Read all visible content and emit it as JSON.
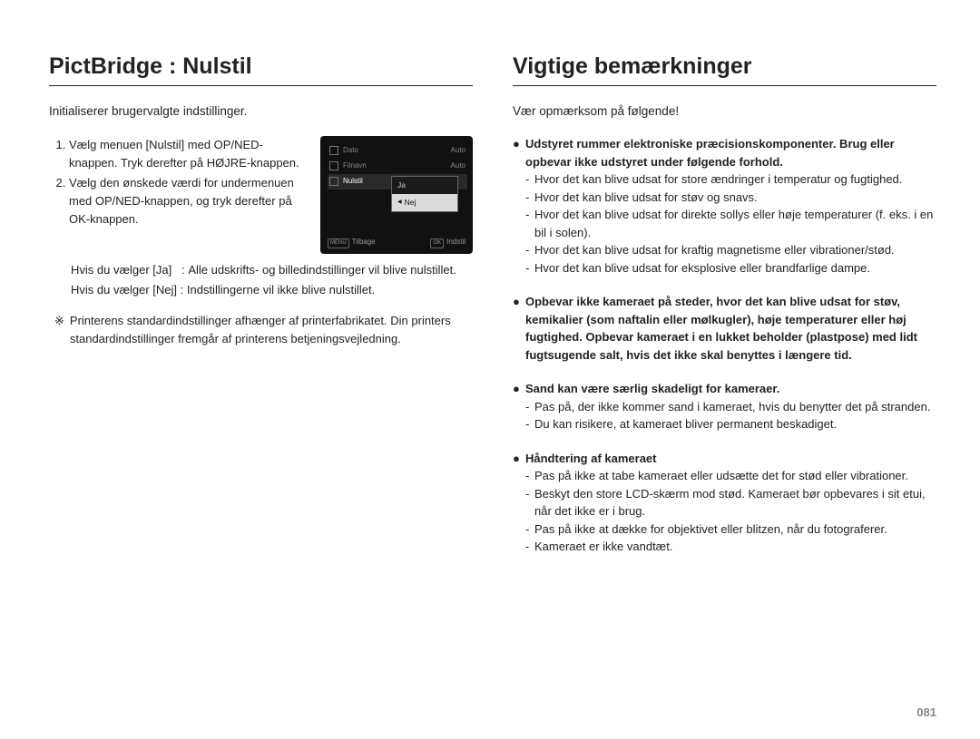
{
  "pageNumber": "081",
  "left": {
    "title": "PictBridge : Nulstil",
    "intro": "Initialiserer brugervalgte indstillinger.",
    "steps": [
      "Vælg menuen [Nulstil] med OP/NED-knappen. Tryk derefter på HØJRE-knappen.",
      "Vælg den ønskede værdi for undermenuen med OP/NED-knappen, og tryk derefter på OK-knappen."
    ],
    "result_yes_label": "Hvis du vælger [Ja]   : ",
    "result_yes_text": "Alle udskrifts- og billedindstillinger vil blive nulstillet.",
    "result_no_label": "Hvis du vælger [Nej] : ",
    "result_no_text": "Indstillingerne vil ikke blive nulstillet.",
    "note_sym": "※",
    "note_text": "Printerens standardindstillinger afhænger af printerfabrikatet. Din printers standardindstillinger fremgår af printerens betjeningsvejledning.",
    "lcd": {
      "rows": [
        {
          "label": "Dato",
          "right": "Auto"
        },
        {
          "label": "Filnavn",
          "right": "Auto"
        },
        {
          "label": "Nulstil",
          "right": ""
        }
      ],
      "sub": {
        "opt1": "Ja",
        "opt2": "Nej"
      },
      "footer_back_badge": "MENU",
      "footer_back": "Tilbage",
      "footer_set_badge": "OK",
      "footer_set": "Indstil"
    }
  },
  "right": {
    "title": "Vigtige bemærkninger",
    "intro": "Vær opmærksom på følgende!",
    "bullets": [
      {
        "head": "Udstyret rummer elektroniske præcisionskomponenter. Brug eller opbevar ikke udstyret under følgende forhold.",
        "dashes": [
          "Hvor det kan blive udsat for store ændringer i temperatur og fugtighed.",
          "Hvor det kan blive udsat for støv og snavs.",
          "Hvor det kan blive udsat for direkte sollys eller høje temperaturer (f. eks. i en bil i solen).",
          "Hvor det kan blive udsat for kraftig magnetisme eller vibrationer/stød.",
          "Hvor det kan blive udsat for eksplosive eller brandfarlige dampe."
        ]
      },
      {
        "head": "Opbevar ikke kameraet på steder, hvor det kan blive udsat for støv, kemikalier (som naftalin eller mølkugler), høje temperaturer eller høj fugtighed. Opbevar kameraet i en lukket beholder (plastpose) med lidt fugtsugende salt, hvis det ikke skal benyttes i længere tid.",
        "dashes": []
      },
      {
        "head": "Sand kan være særlig skadeligt for kameraer.",
        "dashes": [
          "Pas på, der ikke kommer sand i kameraet, hvis du benytter det på stranden.",
          "Du kan risikere, at kameraet bliver permanent beskadiget."
        ]
      },
      {
        "head": "Håndtering af kameraet",
        "dashes": [
          "Pas på ikke at tabe kameraet eller udsætte det for stød eller vibrationer.",
          "Beskyt den store LCD-skærm mod stød. Kameraet bør opbevares i sit etui, når det ikke er i brug.",
          "Pas på ikke at dække for objektivet eller blitzen, når du fotograferer.",
          "Kameraet er ikke vandtæt."
        ]
      }
    ]
  }
}
